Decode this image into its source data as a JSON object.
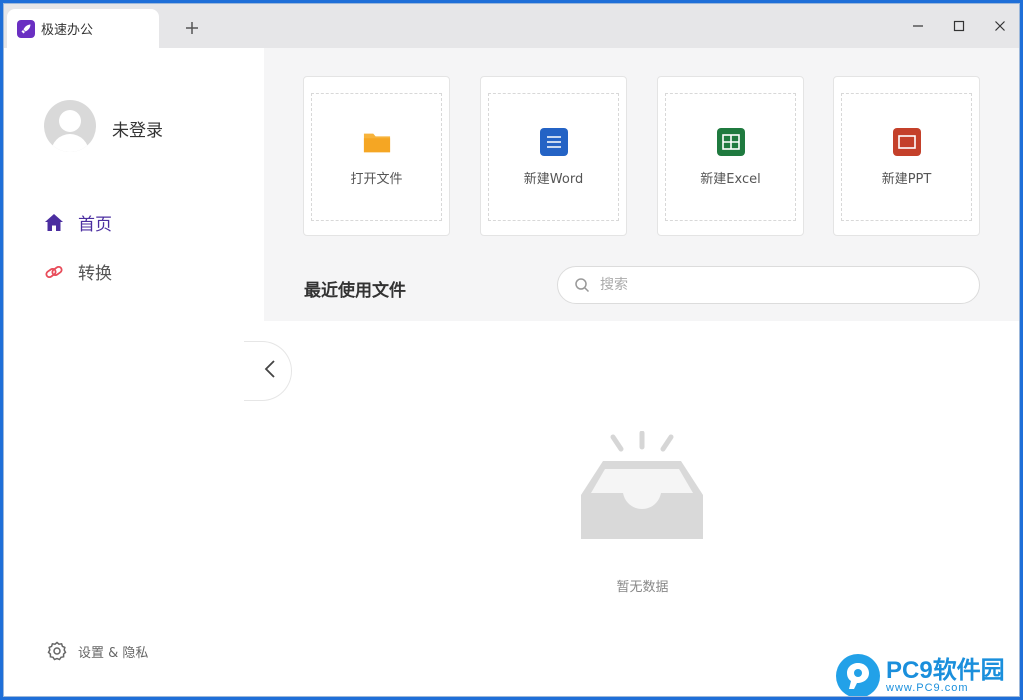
{
  "window": {
    "tab_title": "极速办公",
    "new_tab_icon": "plus-icon",
    "controls": [
      "minimize-icon",
      "maximize-icon",
      "close-icon"
    ]
  },
  "sidebar": {
    "user_status": "未登录",
    "nav": [
      {
        "label": "首页",
        "icon": "home-icon",
        "active": true,
        "color": "#4b2ea0"
      },
      {
        "label": "转换",
        "icon": "convert-icon",
        "active": false,
        "color": "#e84c5a"
      }
    ],
    "settings_label": "设置 & 隐私"
  },
  "actions": [
    {
      "label": "打开文件",
      "icon": "folder-icon",
      "color": "#f5a623"
    },
    {
      "label": "新建Word",
      "icon": "word-icon",
      "color": "#2463c5"
    },
    {
      "label": "新建Excel",
      "icon": "excel-icon",
      "color": "#1f7a3f"
    },
    {
      "label": "新建PPT",
      "icon": "ppt-icon",
      "color": "#c4402a"
    }
  ],
  "recent": {
    "title": "最近使用文件",
    "search_placeholder": "搜索",
    "empty_text": "暂无数据"
  },
  "watermark": {
    "main": "PC9软件园",
    "sub": "www.PC9.com"
  }
}
